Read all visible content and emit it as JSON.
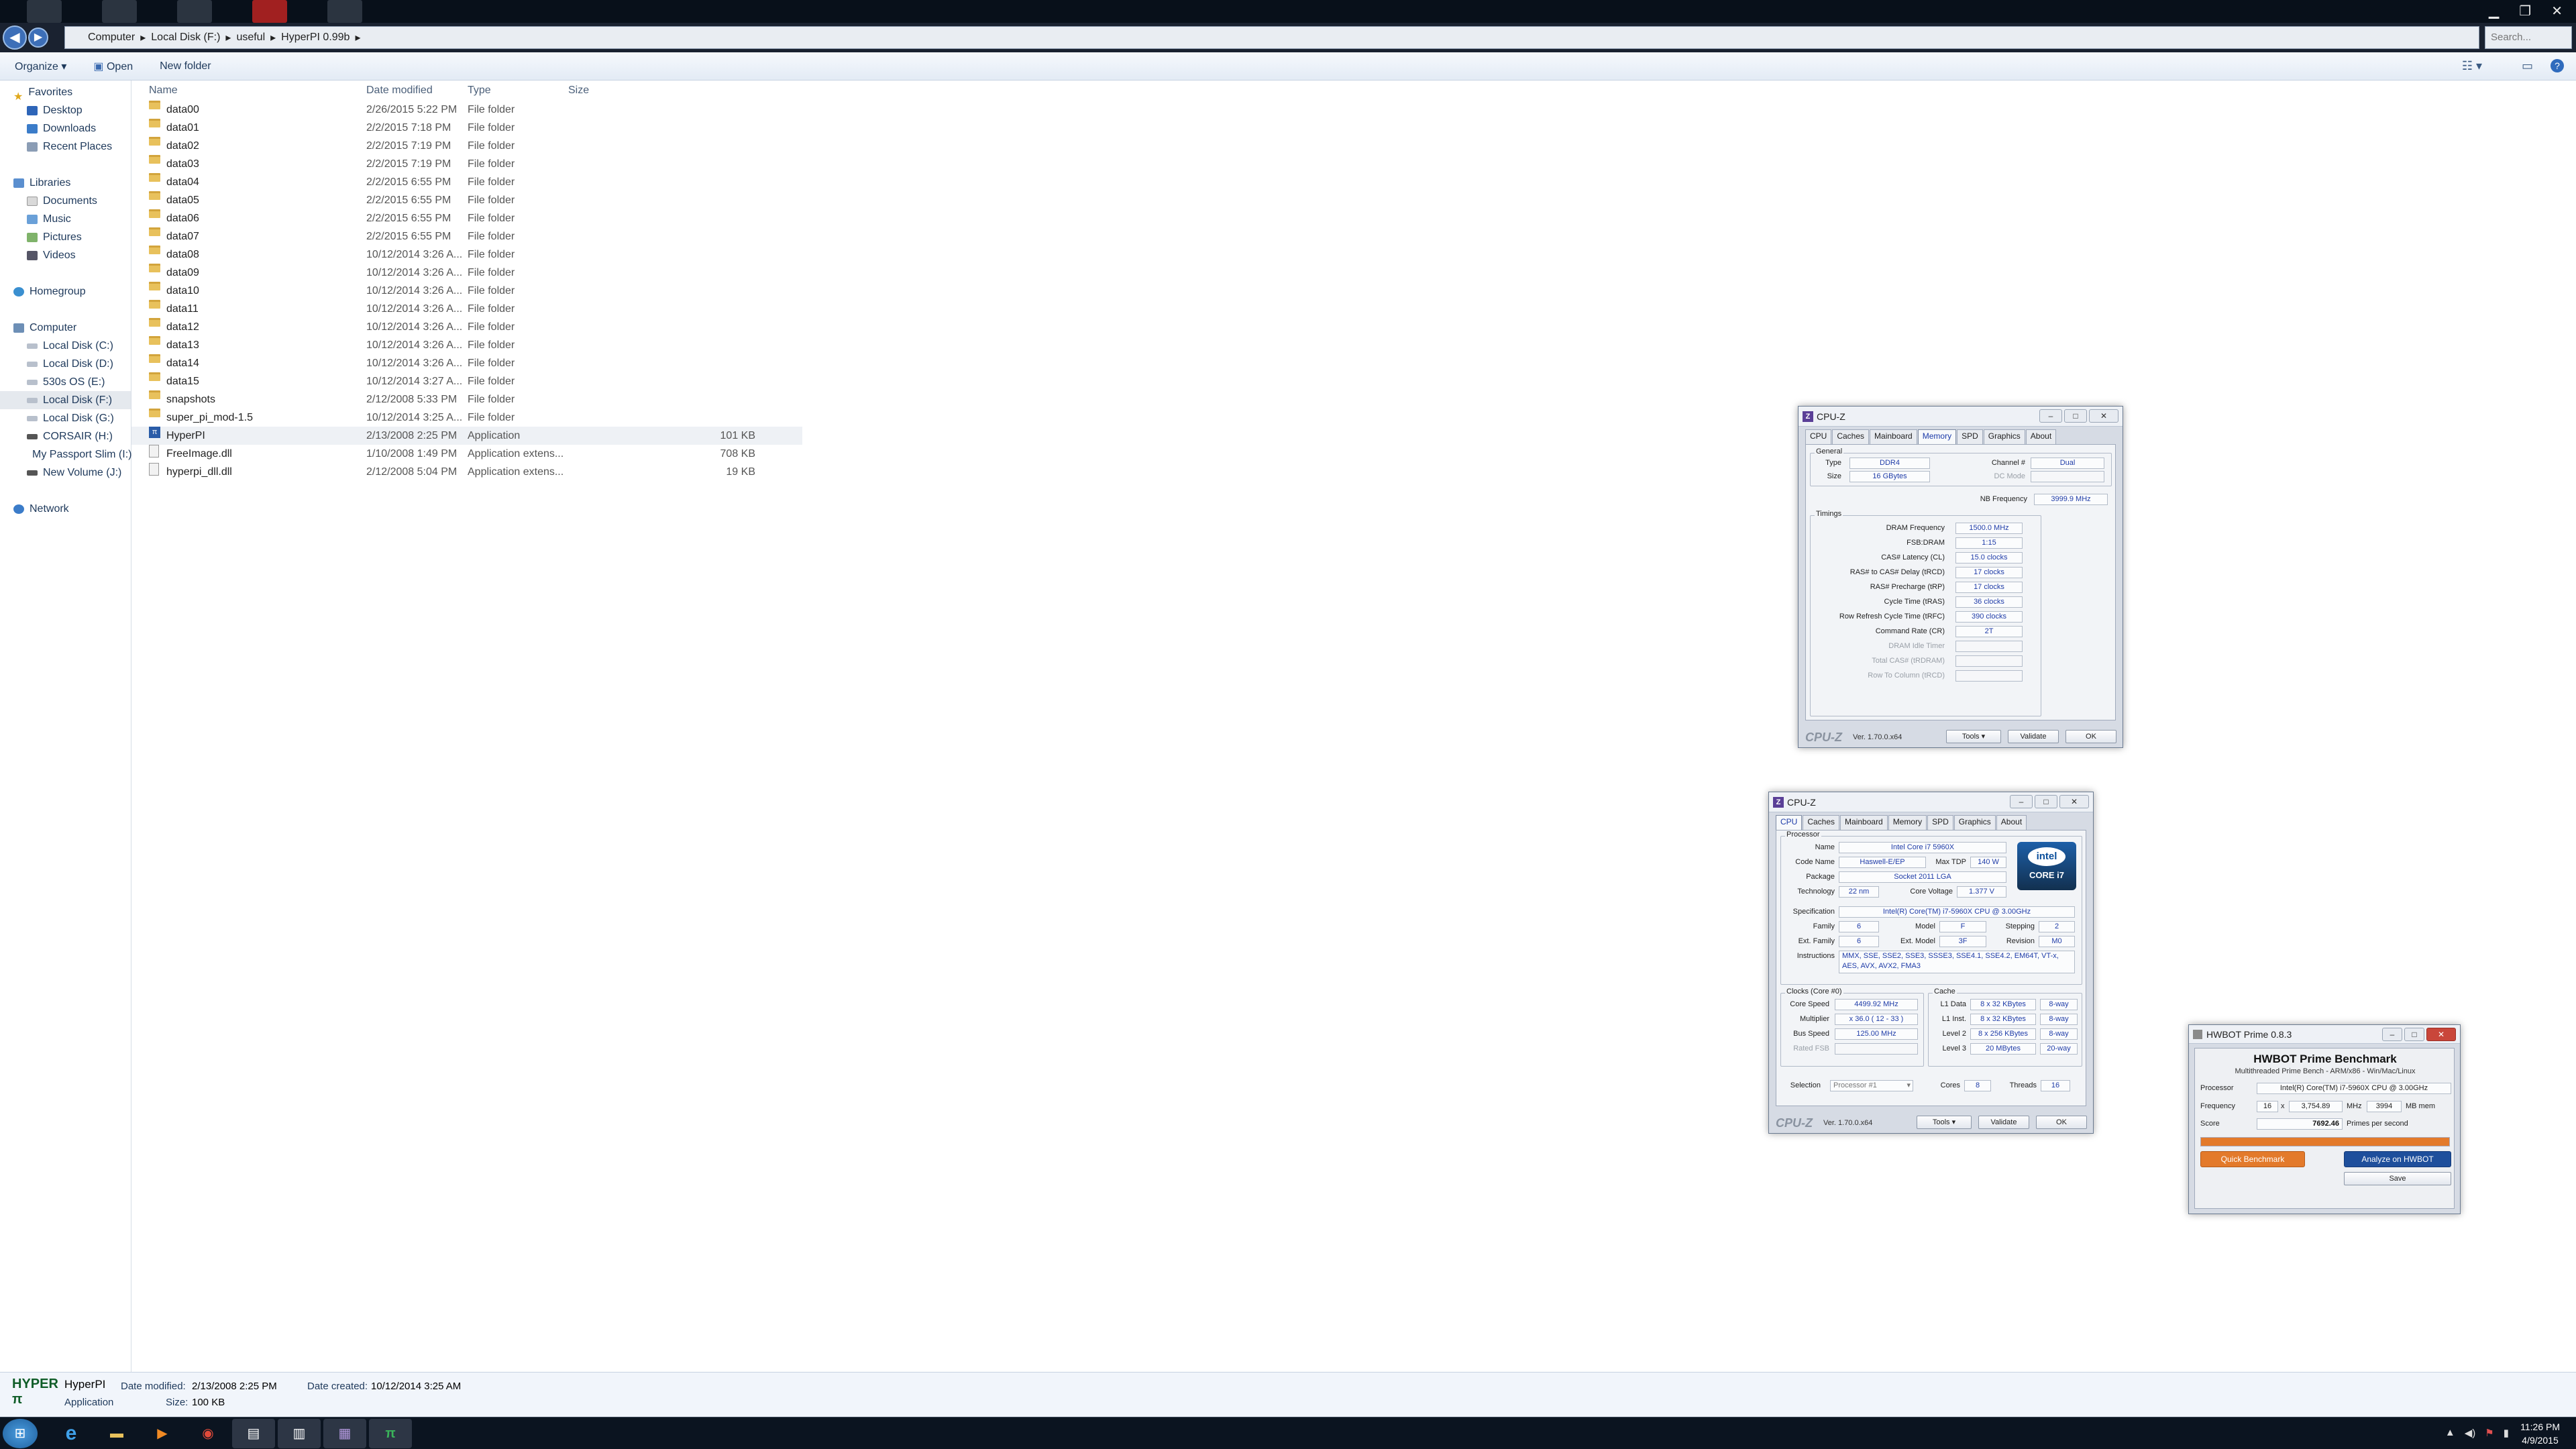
{
  "explorer": {
    "breadcrumb": [
      "Computer",
      "Local Disk (F:)",
      "useful",
      "HyperPI 0.99b"
    ],
    "search_placeholder": "Search...",
    "toolbar": {
      "organize": "Organize ▾",
      "open": "Open",
      "new_folder": "New folder"
    },
    "nav": {
      "favorites": "Favorites",
      "desktop": "Desktop",
      "downloads": "Downloads",
      "recent": "Recent Places",
      "libraries": "Libraries",
      "documents": "Documents",
      "music": "Music",
      "pictures": "Pictures",
      "videos": "Videos",
      "homegroup": "Homegroup",
      "computer": "Computer",
      "disk_c": "Local Disk (C:)",
      "disk_d": "Local Disk (D:)",
      "disk_e": "530s OS (E:)",
      "disk_f": "Local Disk (F:)",
      "disk_g": "Local Disk (G:)",
      "disk_h": "CORSAIR (H:)",
      "disk_i": "My Passport Slim (I:)",
      "disk_j": "New Volume (J:)",
      "network": "Network"
    },
    "columns": {
      "name": "Name",
      "date": "Date modified",
      "type": "Type",
      "size": "Size"
    },
    "files": [
      {
        "name": "data00",
        "date": "2/26/2015 5:22 PM",
        "type": "File folder",
        "size": ""
      },
      {
        "name": "data01",
        "date": "2/2/2015 7:18 PM",
        "type": "File folder",
        "size": ""
      },
      {
        "name": "data02",
        "date": "2/2/2015 7:19 PM",
        "type": "File folder",
        "size": ""
      },
      {
        "name": "data03",
        "date": "2/2/2015 7:19 PM",
        "type": "File folder",
        "size": ""
      },
      {
        "name": "data04",
        "date": "2/2/2015 6:55 PM",
        "type": "File folder",
        "size": ""
      },
      {
        "name": "data05",
        "date": "2/2/2015 6:55 PM",
        "type": "File folder",
        "size": ""
      },
      {
        "name": "data06",
        "date": "2/2/2015 6:55 PM",
        "type": "File folder",
        "size": ""
      },
      {
        "name": "data07",
        "date": "2/2/2015 6:55 PM",
        "type": "File folder",
        "size": ""
      },
      {
        "name": "data08",
        "date": "10/12/2014 3:26 A...",
        "type": "File folder",
        "size": ""
      },
      {
        "name": "data09",
        "date": "10/12/2014 3:26 A...",
        "type": "File folder",
        "size": ""
      },
      {
        "name": "data10",
        "date": "10/12/2014 3:26 A...",
        "type": "File folder",
        "size": ""
      },
      {
        "name": "data11",
        "date": "10/12/2014 3:26 A...",
        "type": "File folder",
        "size": ""
      },
      {
        "name": "data12",
        "date": "10/12/2014 3:26 A...",
        "type": "File folder",
        "size": ""
      },
      {
        "name": "data13",
        "date": "10/12/2014 3:26 A...",
        "type": "File folder",
        "size": ""
      },
      {
        "name": "data14",
        "date": "10/12/2014 3:26 A...",
        "type": "File folder",
        "size": ""
      },
      {
        "name": "data15",
        "date": "10/12/2014 3:27 A...",
        "type": "File folder",
        "size": ""
      },
      {
        "name": "snapshots",
        "date": "2/12/2008 5:33 PM",
        "type": "File folder",
        "size": ""
      },
      {
        "name": "super_pi_mod-1.5",
        "date": "10/12/2014 3:25 A...",
        "type": "File folder",
        "size": ""
      },
      {
        "name": "HyperPI",
        "date": "2/13/2008 2:25 PM",
        "type": "Application",
        "size": "101 KB"
      },
      {
        "name": "FreeImage.dll",
        "date": "1/10/2008 1:49 PM",
        "type": "Application extens...",
        "size": "708 KB"
      },
      {
        "name": "hyperpi_dll.dll",
        "date": "2/12/2008 5:04 PM",
        "type": "Application extens...",
        "size": "19 KB"
      }
    ],
    "details": {
      "name": "HyperPI",
      "kind": "Application",
      "modified_label": "Date modified:",
      "modified": "2/13/2008 2:25 PM",
      "size_label": "Size:",
      "size": "100 KB",
      "created_label": "Date created:",
      "created": "10/12/2014 3:25 AM"
    }
  },
  "cpuz_memory": {
    "title": "CPU-Z",
    "tabs": [
      "CPU",
      "Caches",
      "Mainboard",
      "Memory",
      "SPD",
      "Graphics",
      "About"
    ],
    "general_label": "General",
    "type_label": "Type",
    "type": "DDR4",
    "size_label": "Size",
    "size": "16 GBytes",
    "channel_label": "Channel #",
    "channel": "Dual",
    "dcmode_label": "DC Mode",
    "nbfreq_label": "NB Frequency",
    "nbfreq": "3999.9 MHz",
    "timings_label": "Timings",
    "timings": [
      {
        "label": "DRAM Frequency",
        "value": "1500.0 MHz"
      },
      {
        "label": "FSB:DRAM",
        "value": "1:15"
      },
      {
        "label": "CAS# Latency (CL)",
        "value": "15.0 clocks"
      },
      {
        "label": "RAS# to CAS# Delay (tRCD)",
        "value": "17 clocks"
      },
      {
        "label": "RAS# Precharge (tRP)",
        "value": "17 clocks"
      },
      {
        "label": "Cycle Time (tRAS)",
        "value": "36 clocks"
      },
      {
        "label": "Row Refresh Cycle Time (tRFC)",
        "value": "390 clocks"
      },
      {
        "label": "Command Rate (CR)",
        "value": "2T"
      },
      {
        "label": "DRAM Idle Timer",
        "value": ""
      },
      {
        "label": "Total CAS# (tRDRAM)",
        "value": ""
      },
      {
        "label": "Row To Column (tRCD)",
        "value": ""
      }
    ],
    "logo": "CPU-Z",
    "version": "Ver. 1.70.0.x64",
    "tools": "Tools",
    "validate": "Validate",
    "ok": "OK"
  },
  "cpuz_cpu": {
    "title": "CPU-Z",
    "tabs": [
      "CPU",
      "Caches",
      "Mainboard",
      "Memory",
      "SPD",
      "Graphics",
      "About"
    ],
    "processor_label": "Processor",
    "name_label": "Name",
    "name": "Intel Core i7 5960X",
    "codename_label": "Code Name",
    "codename": "Haswell-E/EP",
    "maxtdp_label": "Max TDP",
    "maxtdp": "140 W",
    "package_label": "Package",
    "package": "Socket 2011 LGA",
    "tech_label": "Technology",
    "tech": "22 nm",
    "corev_label": "Core Voltage",
    "corev": "1.377 V",
    "spec_label": "Specification",
    "spec": "Intel(R) Core(TM) i7-5960X CPU @ 3.00GHz",
    "family_label": "Family",
    "family": "6",
    "model_label": "Model",
    "model": "F",
    "stepping_label": "Stepping",
    "stepping": "2",
    "extfamily_label": "Ext. Family",
    "extfamily": "6",
    "extmodel_label": "Ext. Model",
    "extmodel": "3F",
    "revision_label": "Revision",
    "revision": "M0",
    "instr_label": "Instructions",
    "instr": "MMX, SSE, SSE2, SSE3, SSSE3, SSE4.1, SSE4.2, EM64T, VT-x, AES, AVX, AVX2, FMA3",
    "clocks_label": "Clocks (Core #0)",
    "corespeed_label": "Core Speed",
    "corespeed": "4499.92 MHz",
    "mult_label": "Multiplier",
    "mult": "x 36.0 ( 12 - 33 )",
    "bus_label": "Bus Speed",
    "bus": "125.00 MHz",
    "ratedfsb_label": "Rated FSB",
    "cache_label": "Cache",
    "l1d_label": "L1 Data",
    "l1d": "8 x 32 KBytes",
    "l1d_way": "8-way",
    "l1i_label": "L1 Inst.",
    "l1i": "8 x 32 KBytes",
    "l1i_way": "8-way",
    "l2_label": "Level 2",
    "l2": "8 x 256 KBytes",
    "l2_way": "8-way",
    "l3_label": "Level 3",
    "l3": "20 MBytes",
    "l3_way": "20-way",
    "selection_label": "Selection",
    "selection": "Processor #1",
    "cores_label": "Cores",
    "cores": "8",
    "threads_label": "Threads",
    "threads": "16",
    "intel_a": "intel",
    "intel_b": "CORE i7",
    "logo": "CPU-Z",
    "version": "Ver. 1.70.0.x64",
    "tools": "Tools",
    "validate": "Validate",
    "ok": "OK"
  },
  "hwbot": {
    "title": "HWBOT Prime 0.8.3",
    "heading": "HWBOT Prime Benchmark",
    "subheading": "Multithreaded Prime Bench - ARM/x86 - Win/Mac/Linux",
    "processor_label": "Processor",
    "processor": "Intel(R) Core(TM) i7-5960X CPU @ 3.00GHz",
    "freq_label": "Frequency",
    "threads": "16",
    "x": "x",
    "freq": "3,754.89",
    "mhz": "MHz",
    "mem": "3994",
    "mb": "MB mem",
    "score_label": "Score",
    "score": "7692.46",
    "score_unit": "Primes per second",
    "progress": 100,
    "quick": "Quick Benchmark",
    "analyze": "Analyze on HWBOT",
    "save": "Save"
  },
  "taskbar": {
    "time": "11:26 PM",
    "date": "4/9/2015"
  },
  "colors": {
    "accent": "#1f3ca8",
    "hwbot_orange": "#e37a2b",
    "hwbot_blue": "#1e4f9c"
  }
}
